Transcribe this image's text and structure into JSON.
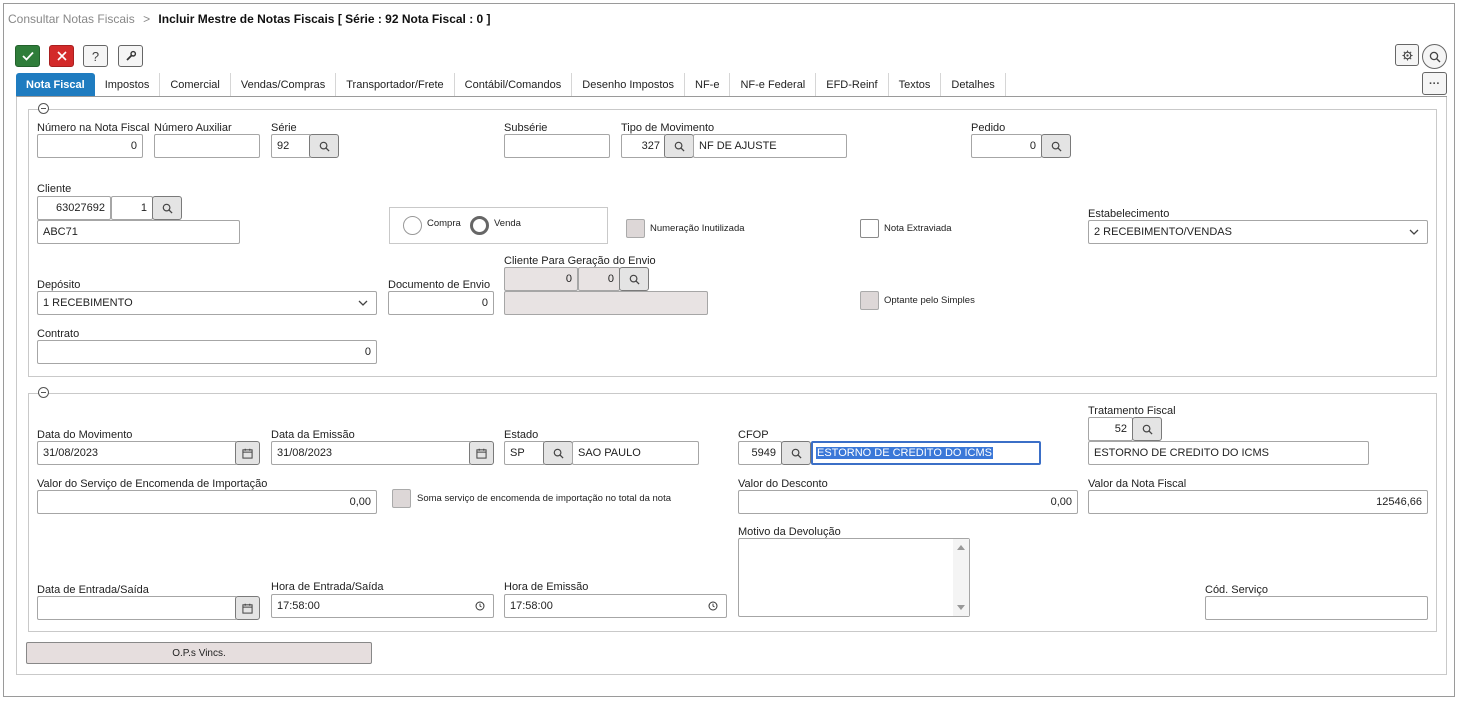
{
  "breadcrumb": {
    "link": "Consultar Notas Fiscais",
    "separator": ">",
    "current": "Incluir Mestre de Notas Fiscais [ Série : 92 Nota Fiscal : 0 ]"
  },
  "toolbar": {
    "confirm_icon": "check-icon",
    "cancel_icon": "close-icon",
    "help_label": "?",
    "tools_icon": "wrench-icon",
    "settings_icon": "gear-icon",
    "search_icon": "search-icon",
    "more_label": "···"
  },
  "tabs": [
    {
      "label": "Nota Fiscal",
      "active": true
    },
    {
      "label": "Impostos"
    },
    {
      "label": "Comercial"
    },
    {
      "label": "Vendas/Compras"
    },
    {
      "label": "Transportador/Frete"
    },
    {
      "label": "Contábil/Comandos"
    },
    {
      "label": "Desenho Impostos"
    },
    {
      "label": "NF-e"
    },
    {
      "label": "NF-e Federal"
    },
    {
      "label": "EFD-Reinf"
    },
    {
      "label": "Textos"
    },
    {
      "label": "Detalhes"
    }
  ],
  "section1": {
    "numero_nf": {
      "label": "Número na Nota Fiscal",
      "value": "0"
    },
    "numero_aux": {
      "label": "Número Auxiliar",
      "value": ""
    },
    "serie": {
      "label": "Série",
      "value": "92"
    },
    "subserie": {
      "label": "Subsérie",
      "value": ""
    },
    "tipo_mov": {
      "label": "Tipo de Movimento",
      "code": "327",
      "desc": "NF DE AJUSTE"
    },
    "pedido": {
      "label": "Pedido",
      "value": "0"
    },
    "cliente": {
      "label": "Cliente",
      "code": "63027692",
      "seq": "1",
      "name": "ABC71"
    },
    "compra_label": "Compra",
    "venda_label": "Venda",
    "selected_type": "Venda",
    "numeracao_label": "Numeração Inutilizada",
    "nota_extraviada_label": "Nota Extraviada",
    "estabelecimento": {
      "label": "Estabelecimento",
      "value": "2 RECEBIMENTO/VENDAS"
    },
    "deposito": {
      "label": "Depósito",
      "value": "1 RECEBIMENTO"
    },
    "doc_envio": {
      "label": "Documento de Envio",
      "value": "0"
    },
    "cliente_envio": {
      "label": "Cliente Para Geração do Envio",
      "code": "0",
      "seq": "0",
      "name": ""
    },
    "optante_label": "Optante pelo Simples",
    "contrato": {
      "label": "Contrato",
      "value": "0"
    }
  },
  "section2": {
    "data_mov": {
      "label": "Data do Movimento",
      "value": "31/08/2023"
    },
    "data_emissao": {
      "label": "Data da Emissão",
      "value": "31/08/2023"
    },
    "estado": {
      "label": "Estado",
      "code": "SP",
      "name": "SAO PAULO"
    },
    "cfop": {
      "label": "CFOP",
      "code": "5949",
      "desc": "ESTORNO DE CREDITO DO ICMS"
    },
    "tratamento": {
      "label": "Tratamento Fiscal",
      "code": "52",
      "desc": "ESTORNO DE CREDITO DO ICMS"
    },
    "valor_servico": {
      "label": "Valor do Serviço de Encomenda de Importação",
      "value": "0,00"
    },
    "soma_servico_label": "Soma serviço de encomenda de importação no total da nota",
    "valor_desconto": {
      "label": "Valor do Desconto",
      "value": "0,00"
    },
    "valor_nf": {
      "label": "Valor da Nota Fiscal",
      "value": "12546,66"
    },
    "motivo": {
      "label": "Motivo da Devolução",
      "value": ""
    },
    "data_entrada": {
      "label": "Data de Entrada/Saída",
      "value": ""
    },
    "hora_entrada": {
      "label": "Hora de Entrada/Saída",
      "value": "17:58:00"
    },
    "hora_emissao": {
      "label": "Hora de Emissão",
      "value": "17:58:00"
    },
    "cod_servico": {
      "label": "Cód. Serviço",
      "value": ""
    }
  },
  "ops_button": "O.P.s Vincs."
}
